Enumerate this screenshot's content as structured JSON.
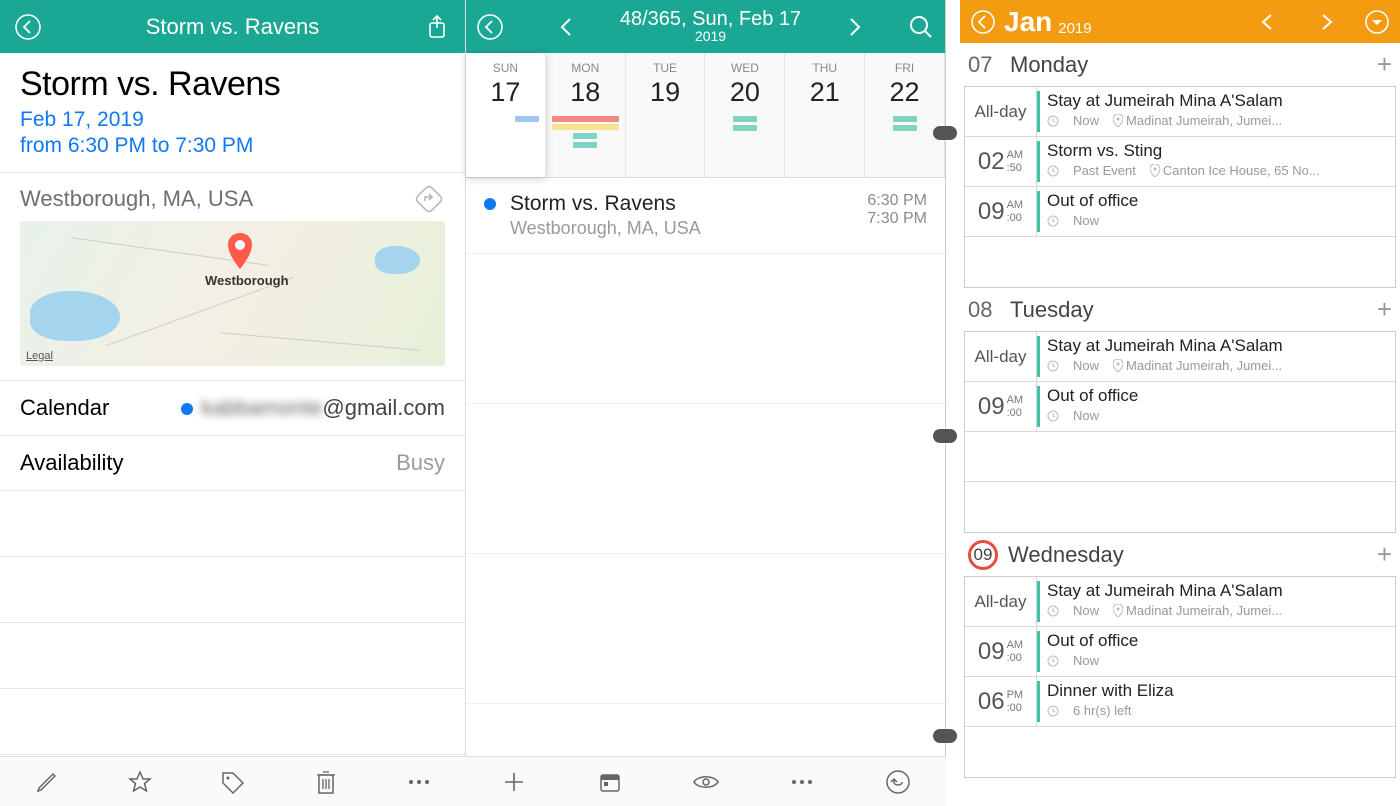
{
  "left": {
    "header_title": "Storm vs. Ravens",
    "event_title": "Storm vs. Ravens",
    "event_date": "Feb 17, 2019",
    "event_time": "from 6:30 PM to 7:30 PM",
    "location": "Westborough, MA, USA",
    "map_legal": "Legal",
    "map_label": "Westborough",
    "calendar_label": "Calendar",
    "calendar_email_blur": "kabbamonte",
    "calendar_email_clear": "@gmail.com",
    "availability_label": "Availability",
    "availability_value": "Busy"
  },
  "middle": {
    "title": "48/365, Sun, Feb 17",
    "year": "2019",
    "days": [
      {
        "abbr": "SUN",
        "num": "17"
      },
      {
        "abbr": "MON",
        "num": "18"
      },
      {
        "abbr": "TUE",
        "num": "19"
      },
      {
        "abbr": "WED",
        "num": "20"
      },
      {
        "abbr": "THU",
        "num": "21"
      },
      {
        "abbr": "FRI",
        "num": "22"
      }
    ],
    "event": {
      "title": "Storm vs. Ravens",
      "location": "Westborough, MA, USA",
      "start": "6:30 PM",
      "end": "7:30 PM"
    }
  },
  "right": {
    "month": "Jan",
    "year": "2019",
    "days": [
      {
        "num": "07",
        "name": "Monday",
        "today": false,
        "events": [
          {
            "time_type": "allday",
            "title": "Stay at Jumeirah Mina A'Salam",
            "sub": "Now",
            "loc": "Madinat Jumeirah, Jumei..."
          },
          {
            "time_type": "time",
            "h": "02",
            "ampm": "AM",
            "m": ":50",
            "title": "Storm vs. Sting",
            "sub": "Past Event",
            "loc": "Canton Ice House, 65 No..."
          },
          {
            "time_type": "time",
            "h": "09",
            "ampm": "AM",
            "m": ":00",
            "title": "Out of office",
            "sub": "Now",
            "loc": ""
          }
        ]
      },
      {
        "num": "08",
        "name": "Tuesday",
        "today": false,
        "events": [
          {
            "time_type": "allday",
            "title": "Stay at Jumeirah Mina A'Salam",
            "sub": "Now",
            "loc": "Madinat Jumeirah, Jumei..."
          },
          {
            "time_type": "time",
            "h": "09",
            "ampm": "AM",
            "m": ":00",
            "title": "Out of office",
            "sub": "Now",
            "loc": ""
          }
        ]
      },
      {
        "num": "09",
        "name": "Wednesday",
        "today": true,
        "events": [
          {
            "time_type": "allday",
            "title": "Stay at Jumeirah Mina A'Salam",
            "sub": "Now",
            "loc": "Madinat Jumeirah, Jumei..."
          },
          {
            "time_type": "time",
            "h": "09",
            "ampm": "AM",
            "m": ":00",
            "title": "Out of office",
            "sub": "Now",
            "loc": ""
          },
          {
            "time_type": "time",
            "h": "06",
            "ampm": "PM",
            "m": ":00",
            "title": "Dinner with Eliza",
            "sub": "6 hr(s) left",
            "loc": ""
          }
        ]
      }
    ],
    "allday_label": "All-day"
  }
}
